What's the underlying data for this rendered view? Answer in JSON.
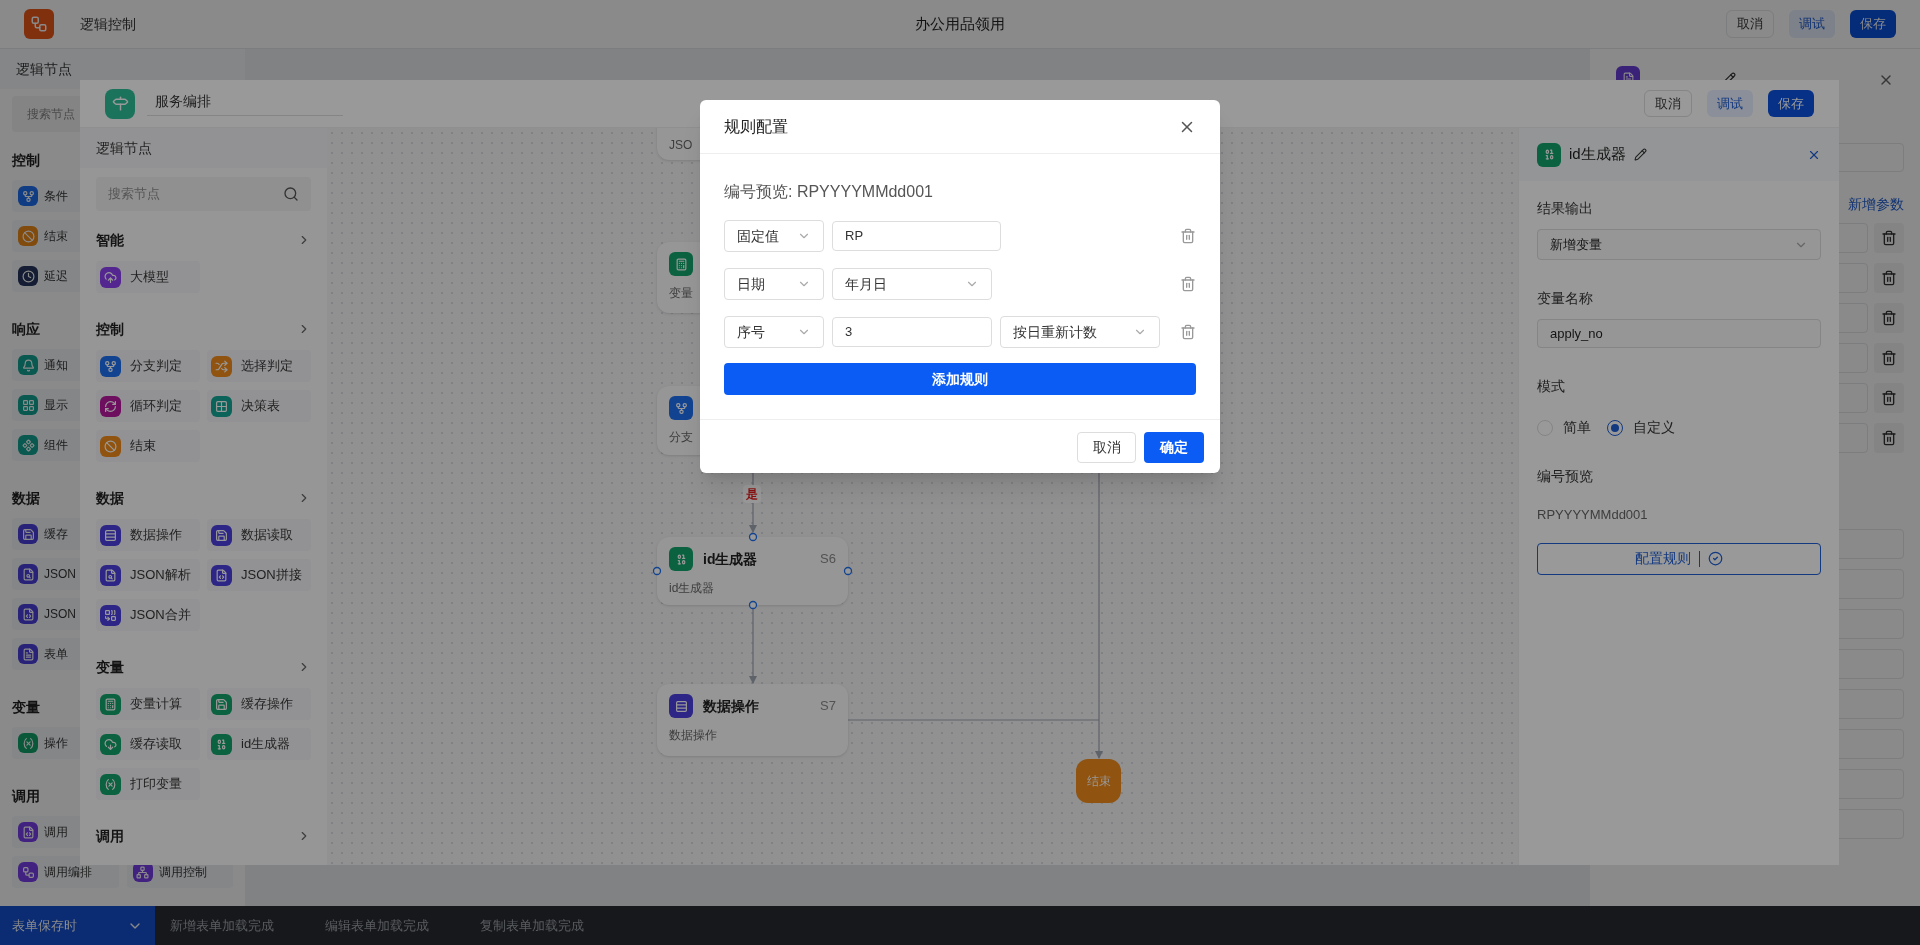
{
  "app": {
    "title": "逻辑控制",
    "page_title": "办公用品领用",
    "buttons": [
      {
        "label": "取消",
        "kind": "outline"
      },
      {
        "label": "调试",
        "kind": "soft"
      },
      {
        "label": "保存",
        "kind": "primary"
      }
    ]
  },
  "sidebar": {
    "title": "逻辑节点",
    "search_placeholder": "搜索节点",
    "groups": [
      {
        "title": "控制",
        "rows": [
          [
            {
              "label": "条件",
              "color": "#103c83"
            }
          ],
          [
            {
              "label": "结束",
              "color": "#814b0e"
            }
          ],
          [
            {
              "label": "延迟",
              "color": "#141d33"
            }
          ]
        ]
      },
      {
        "title": "响应",
        "rows": [
          [
            {
              "label": "通知",
              "color": "#0a5950"
            }
          ],
          [
            {
              "label": "显示",
              "color": "#0a5950"
            }
          ],
          [
            {
              "label": "组件",
              "color": "#0a5950"
            }
          ]
        ]
      },
      {
        "title": "数据",
        "rows": [
          [
            {
              "label": "缓存",
              "color": "#292279"
            }
          ],
          [
            {
              "label": "JSON",
              "color": "#292279"
            }
          ],
          [
            {
              "label": "JSON",
              "color": "#292279"
            }
          ],
          [
            {
              "label": "表单",
              "color": "#292279"
            }
          ]
        ]
      },
      {
        "title": "变量",
        "rows": [
          [
            {
              "label": "操作",
              "color": "#0a583a"
            }
          ]
        ]
      },
      {
        "title": "调用",
        "rows": [
          [
            {
              "label": "调用",
              "color": "#422281"
            }
          ],
          [
            {
              "label": "调用编排",
              "color": "#422281"
            },
            {
              "label": "调用控制",
              "color": "#422281"
            }
          ]
        ]
      }
    ]
  },
  "side_panel": {
    "link": "新增参数"
  },
  "trigger_bar": {
    "trigger": "表单保存时",
    "tabs": [
      "新增表单加载完成",
      "编辑表单加载完成",
      "复制表单加载完成"
    ]
  },
  "orchestration": {
    "title": "服务编排",
    "buttons": [
      {
        "label": "取消",
        "kind": "outline"
      },
      {
        "label": "调试",
        "kind": "soft"
      },
      {
        "label": "保存",
        "kind": "primary"
      }
    ],
    "palette": {
      "title": "逻辑节点",
      "search_placeholder": "搜索节点",
      "groups": [
        {
          "title": "智能",
          "items": [
            {
              "label": "大模型",
              "color": "#532690"
            }
          ]
        },
        {
          "title": "控制",
          "items": [
            {
              "label": "分支判定",
              "color": "#114391"
            },
            {
              "label": "选择判定",
              "color": "#905410"
            },
            {
              "label": "循环判定",
              "color": "#6d0e5f"
            },
            {
              "label": "决策表",
              "color": "#0b6359"
            },
            {
              "label": "结束",
              "color": "#905410"
            }
          ]
        },
        {
          "title": "数据",
          "items": [
            {
              "label": "数据操作",
              "color": "#2d2686"
            },
            {
              "label": "数据读取",
              "color": "#2d2686"
            },
            {
              "label": "JSON解析",
              "color": "#2d2686"
            },
            {
              "label": "JSON拼接",
              "color": "#2d2686"
            },
            {
              "label": "JSON合并",
              "color": "#2d2686"
            }
          ]
        },
        {
          "title": "变量",
          "items": [
            {
              "label": "变量计算",
              "color": "#0b6240"
            },
            {
              "label": "缓存操作",
              "color": "#0b6240"
            },
            {
              "label": "缓存读取",
              "color": "#0b6240"
            },
            {
              "label": "id生成器",
              "color": "#0b6240"
            },
            {
              "label": "打印变量",
              "color": "#0b6240"
            }
          ]
        },
        {
          "title": "调用"
        }
      ]
    },
    "canvas": {
      "nodes": [
        {
          "kind": "card",
          "subtitle": "JSO"
        },
        {
          "kind": "card",
          "color": "#0b6240",
          "subtitle": "变量"
        },
        {
          "kind": "card",
          "color": "#114391",
          "subtitle": "分支"
        },
        {
          "kind": "card",
          "color": "#0b6240",
          "title": "id生成器",
          "code": "S6",
          "subtitle": "id生成器"
        },
        {
          "kind": "card",
          "color": "#2d2686",
          "title": "数据操作",
          "code": "S7",
          "subtitle": "数据操作"
        },
        {
          "kind": "terminal",
          "color": "#905410",
          "title": "结束"
        }
      ],
      "edge_label": "是"
    },
    "properties": {
      "title": "id生成器",
      "color": "#0b6240",
      "output_label": "结果输出",
      "output_value": "新增变量",
      "name_label": "变量名称",
      "name_value": "apply_no",
      "mode_label": "模式",
      "modes": [
        {
          "label": "简单",
          "selected": false
        },
        {
          "label": "自定义",
          "selected": true
        }
      ],
      "preview_label": "编号预览",
      "preview_value": "RPYYYYMMdd001",
      "config_button": "配置规则"
    }
  },
  "dialog": {
    "title": "规则配置",
    "preview": "编号预览: RPYYYYMMdd001",
    "rules": [
      {
        "type": "固定值",
        "fields": [
          {
            "kind": "input",
            "value": "RP"
          }
        ]
      },
      {
        "type": "日期",
        "fields": [
          {
            "kind": "select",
            "value": "年月日"
          }
        ]
      },
      {
        "type": "序号",
        "fields": [
          {
            "kind": "input",
            "value": "3"
          },
          {
            "kind": "select",
            "value": "按日重新计数"
          }
        ]
      }
    ],
    "add_button": "添加规则",
    "cancel": "取消",
    "ok": "确定"
  }
}
